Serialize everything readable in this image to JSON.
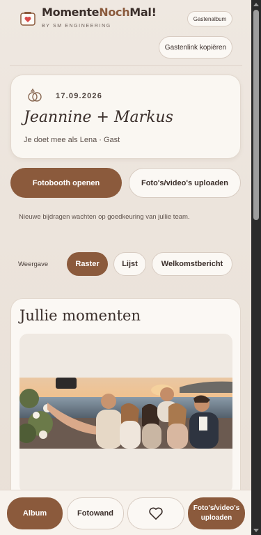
{
  "header": {
    "brand_part1": "Momente",
    "brand_part2": "Noch",
    "brand_part3": "Mal!",
    "sub_brand": "BY SM ENGINEERING",
    "gastenalbum_label": "Gastenalbum",
    "gastenlink_label": "Gastenlink kopiëren"
  },
  "event": {
    "date": "17.09.2026",
    "couple": "Jeannine + Markus",
    "guest_line": "Je doet mee als Lena · Gast"
  },
  "actions": {
    "fotobooth_label": "Fotobooth openen",
    "upload_label": "Foto's/video's uploaden"
  },
  "notice": "Nieuwe bijdragen wachten op goedkeuring van jullie team.",
  "view": {
    "label": "Weergave",
    "options": [
      "Raster",
      "Lijst",
      "Welkomstbericht"
    ],
    "selected": "Raster"
  },
  "album": {
    "title": "Jullie momenten"
  },
  "bottom_nav": {
    "album_label": "Album",
    "fotowand_label": "Fotowand",
    "heart_icon": "heart-icon",
    "upload_label": "Foto's/video's uploaden"
  },
  "colors": {
    "accent": "#8b5a3c",
    "background": "#ece4dc",
    "card": "#faf7f2"
  }
}
